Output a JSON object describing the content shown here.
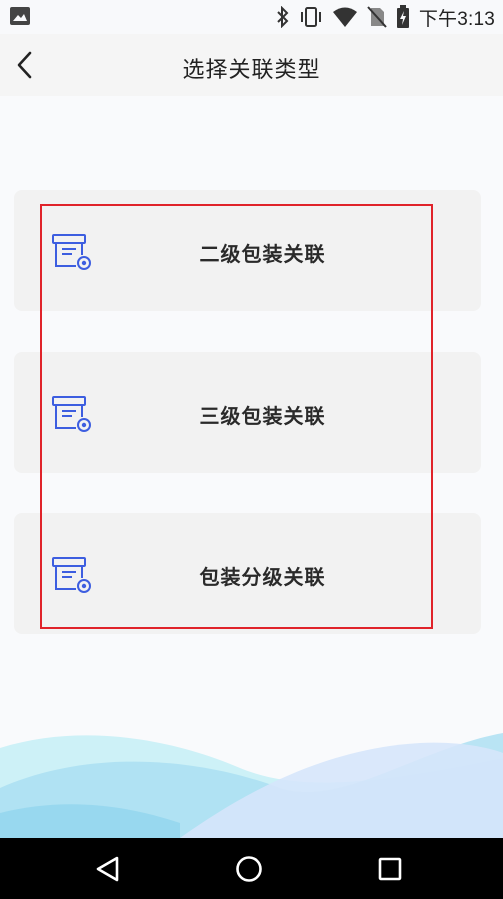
{
  "status_bar": {
    "time": "下午3:13",
    "icons": [
      "image-icon",
      "bluetooth-icon",
      "vibrate-icon",
      "wifi-icon",
      "no-sim-icon",
      "battery-icon"
    ]
  },
  "header": {
    "title": "选择关联类型",
    "back_icon": "chevron-left-icon"
  },
  "cards": [
    {
      "label": "二级包装关联",
      "icon": "package-box-icon"
    },
    {
      "label": "三级包装关联",
      "icon": "package-box-icon"
    },
    {
      "label": "包装分级关联",
      "icon": "package-box-icon"
    }
  ],
  "colors": {
    "icon_accent": "#3d5ee0",
    "highlight_border": "#e0232a",
    "card_background": "#f2f2f2"
  },
  "nav_bar": {
    "buttons": [
      "back-triangle-icon",
      "home-circle-icon",
      "recents-square-icon"
    ]
  }
}
